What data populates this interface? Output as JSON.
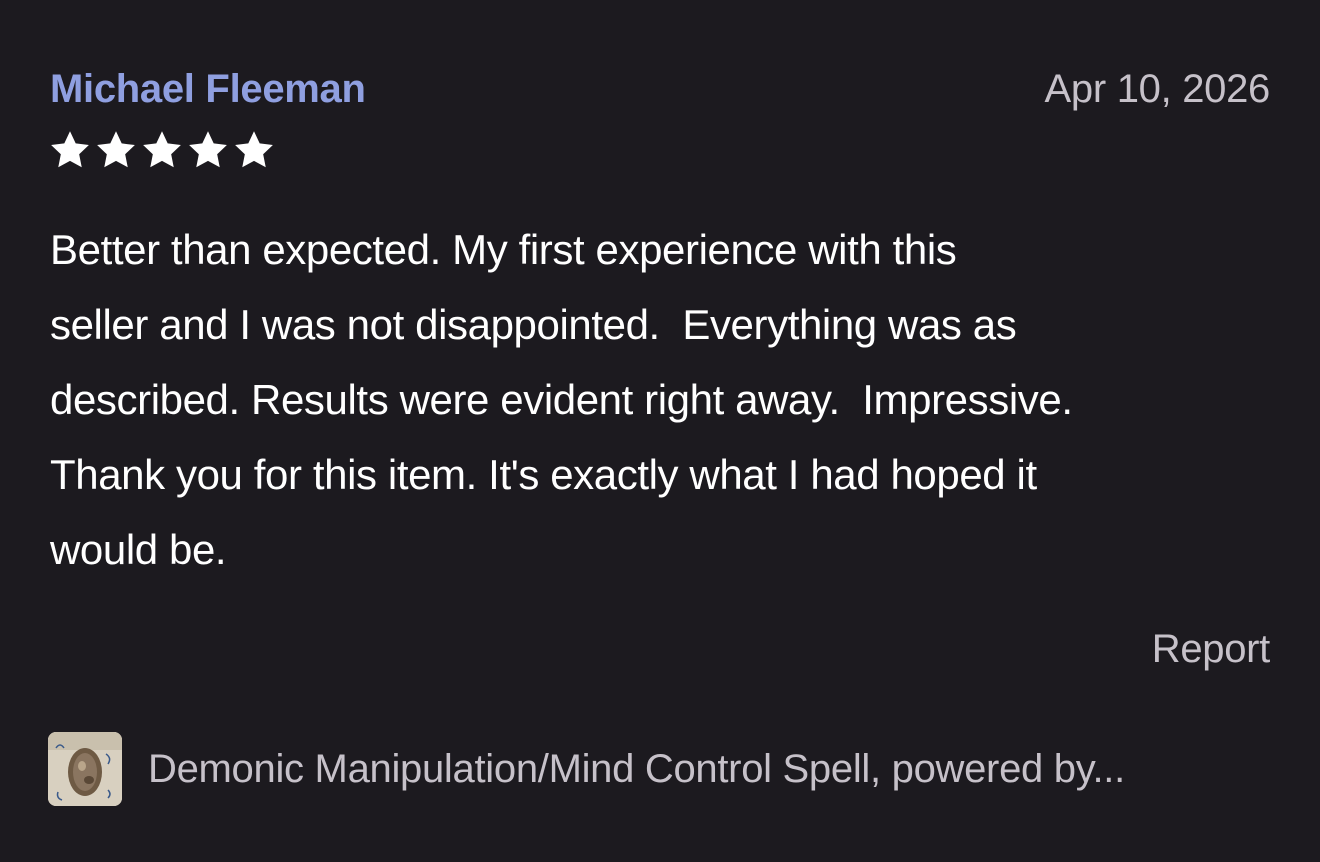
{
  "review": {
    "reviewer_name": "Michael Fleeman",
    "date": "Apr 10, 2026",
    "rating": 5,
    "rating_max": 5,
    "text": "Better than expected. My first experience with this\nseller and I was not disappointed.  Everything was as\ndescribed. Results were evident right away.  Impressive.\nThank you for this item. It's exactly what I had hoped it\nwould be.",
    "report_label": "Report"
  },
  "product": {
    "title": "Demonic Manipulation/Mind Control Spell, powered by...",
    "thumbnail_icon": "product-thumbnail"
  },
  "colors": {
    "background": "#1c1a1f",
    "reviewer_name": "#8f9fe0",
    "muted_text": "#c6c1c9",
    "body_text": "#ffffff",
    "star": "#ffffff"
  }
}
